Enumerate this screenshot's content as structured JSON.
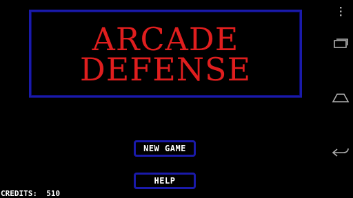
{
  "title": {
    "line1": "ARCADE",
    "line2": "DEFENSE"
  },
  "menu": {
    "new_game_label": "NEW GAME",
    "help_label": "HELP"
  },
  "status": {
    "credits_label": "CREDITS:",
    "credits_value": "510"
  },
  "nav_icons": {
    "overflow": "overflow-menu-icon",
    "recents": "recent-apps-icon",
    "home": "home-icon",
    "back": "back-icon"
  },
  "colors": {
    "background": "#000000",
    "title_red": "#e01e1e",
    "frame_blue": "#1a1aaa",
    "text_white": "#ffffff",
    "nav_icon_gray": "#b0b0b0"
  }
}
